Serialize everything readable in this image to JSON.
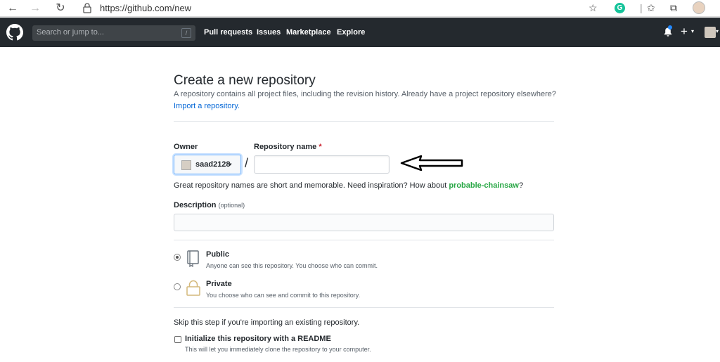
{
  "browser": {
    "url": "https://github.com/new",
    "back_glyph": "←",
    "forward_glyph": "→",
    "reload_glyph": "↻",
    "star_glyph": "☆",
    "grammarly_glyph": "G",
    "more_glyph": "⋯",
    "favorites_glyph": "✩",
    "collections_glyph": "⧉"
  },
  "header": {
    "search_placeholder": "Search or jump to...",
    "search_shortcut": "/",
    "nav": [
      "Pull requests",
      "Issues",
      "Marketplace",
      "Explore"
    ],
    "plus_glyph": "+",
    "caret_glyph": "▾"
  },
  "page": {
    "title": "Create a new repository",
    "subtitle": "A repository contains all project files, including the revision history. Already have a project repository elsewhere?",
    "import_link": "Import a repository."
  },
  "form": {
    "owner_label": "Owner",
    "owner_name": "saad2128",
    "owner_caret": "▾",
    "slash": "/",
    "repo_label": "Repository name",
    "required_mark": "*",
    "repo_value": "",
    "hint_text": "Great repository names are short and memorable. Need inspiration? How about ",
    "hint_suggestion": "probable-chainsaw",
    "hint_end": "?",
    "description_label": "Description",
    "description_optional": "(optional)",
    "description_value": ""
  },
  "visibility": {
    "public_title": "Public",
    "public_desc": "Anyone can see this repository. You choose who can commit.",
    "private_title": "Private",
    "private_desc": "You choose who can see and commit to this repository.",
    "selected": "public"
  },
  "init": {
    "skip_text": "Skip this step if you're importing an existing repository.",
    "readme_label": "Initialize this repository with a README",
    "readme_desc": "This will let you immediately clone the repository to your computer.",
    "readme_checked": false
  },
  "colors": {
    "header_bg": "#24292e",
    "link": "#0366d6",
    "suggestion": "#28a745",
    "required": "#cb2431"
  }
}
